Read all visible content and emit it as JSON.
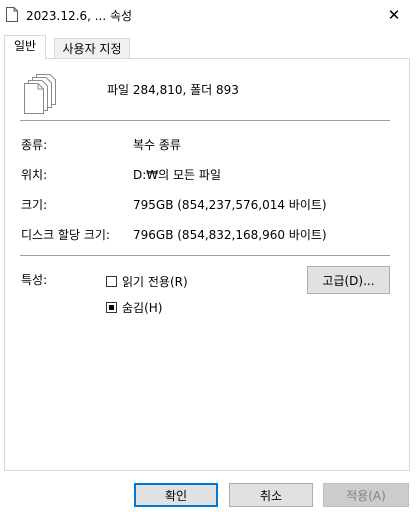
{
  "window": {
    "title": "2023.12.6, ... 속성",
    "close_glyph": "✕"
  },
  "tabs": [
    {
      "label": "일반"
    },
    {
      "label": "사용자 지정"
    }
  ],
  "summary": "파일 284,810, 폴더 893",
  "properties": {
    "type_label": "종류:",
    "type_value": "복수 종류",
    "location_label": "위치:",
    "location_value": "D:₩의 모든 파일",
    "size_label": "크기:",
    "size_value": "795GB (854,237,576,014 바이트)",
    "disk_size_label": "디스크 할당 크기:",
    "disk_size_value": "796GB (854,832,168,960 바이트)"
  },
  "attributes": {
    "label": "특성:",
    "readonly_label": "읽기 전용(R)",
    "readonly_state": "unchecked",
    "hidden_label": "숨김(H)",
    "hidden_state": "indeterminate",
    "advanced_label": "고급(D)..."
  },
  "footer": {
    "ok_label": "확인",
    "cancel_label": "취소",
    "apply_label": "적용(A)"
  }
}
